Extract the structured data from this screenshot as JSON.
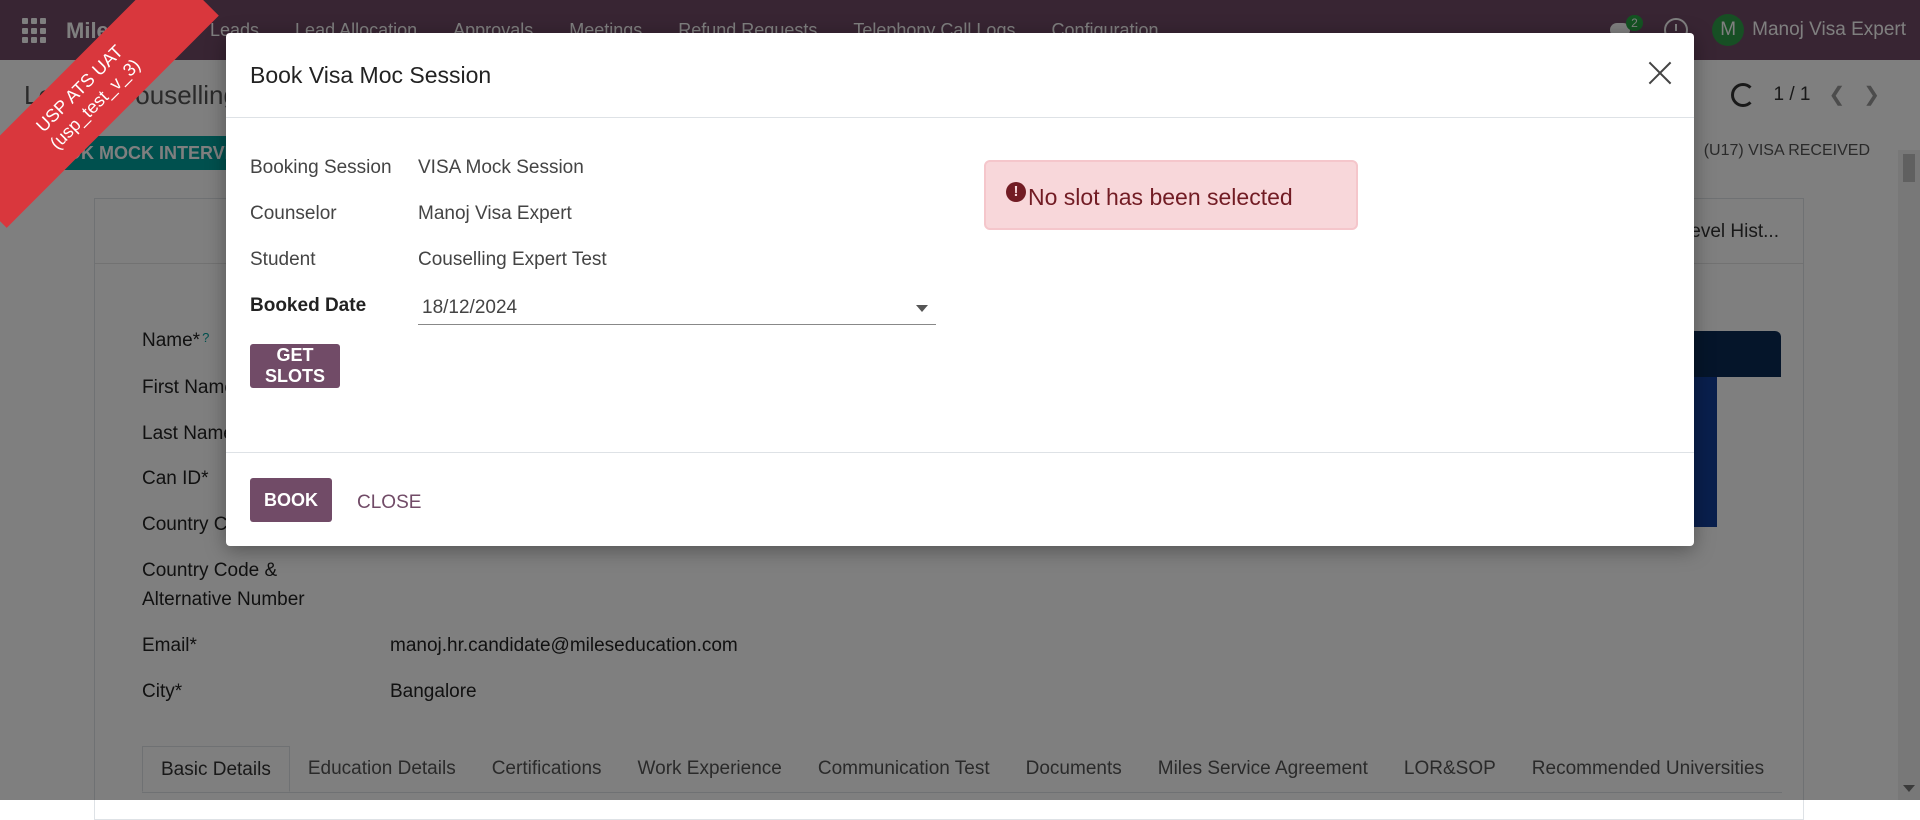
{
  "navbar": {
    "brand": "Miles ATS",
    "menu": [
      "Leads",
      "Lead Allocation",
      "Approvals",
      "Meetings",
      "Refund Requests",
      "Telephony Call Logs",
      "Configuration"
    ],
    "chat_badge": "2",
    "avatar_initial": "M",
    "user_name": "Manoj Visa Expert"
  },
  "ribbon": {
    "line1": "USP ATS UAT",
    "line2": "(usp_test_v_3)"
  },
  "control_panel": {
    "breadcrumb": "Leads / Couselling Expert Test",
    "pager": "1 / 1",
    "book_mock_button": "BOOK MOCK INTERVIEW",
    "stage": "(U17) VISA RECEIVED",
    "level_history": "Level Hist..."
  },
  "form": {
    "fields": [
      {
        "label": "Name*",
        "value": ""
      },
      {
        "label": "First Name",
        "value": ""
      },
      {
        "label": "Last Name",
        "value": ""
      },
      {
        "label": "Can ID*",
        "value": ""
      },
      {
        "label": "Country Code",
        "value": ""
      },
      {
        "label": "Country Code &",
        "value": ""
      },
      {
        "label": "Alternative Number",
        "value": ""
      },
      {
        "label": "Email*",
        "value": "manoj.hr.candidate@mileseducation.com"
      },
      {
        "label": "City*",
        "value": "Bangalore"
      }
    ],
    "help_mark": "?"
  },
  "tabs": [
    "Basic Details",
    "Education Details",
    "Certifications",
    "Work Experience",
    "Communication Test",
    "Documents",
    "Miles Service Agreement",
    "LOR&SOP",
    "Recommended Universities"
  ],
  "modal": {
    "title": "Book Visa Moc Session",
    "booking_session_label": "Booking Session",
    "booking_session_value": "VISA Mock Session",
    "counselor_label": "Counselor",
    "counselor_value": "Manoj Visa Expert",
    "student_label": "Student",
    "student_value": "Couselling Expert Test",
    "booked_date_label": "Booked Date",
    "booked_date_value": "18/12/2024",
    "get_slots_button": "GET SLOTS",
    "alert_icon": "!",
    "alert_message": "No slot has been selected",
    "book_button": "BOOK",
    "close_button": "CLOSE"
  },
  "colors": {
    "navbar": "#714b67",
    "primary_button": "#714b67",
    "alert_bg": "#f8d7da",
    "alert_text": "#721c24",
    "ribbon": "#d9373d",
    "teal_button": "#00a09d"
  },
  "icons": [
    "apps-grid-icon",
    "chat-icon",
    "clock-icon",
    "refresh-icon",
    "chevron-left-icon",
    "chevron-right-icon",
    "close-icon",
    "caret-down-icon",
    "exclamation-circle-icon"
  ]
}
